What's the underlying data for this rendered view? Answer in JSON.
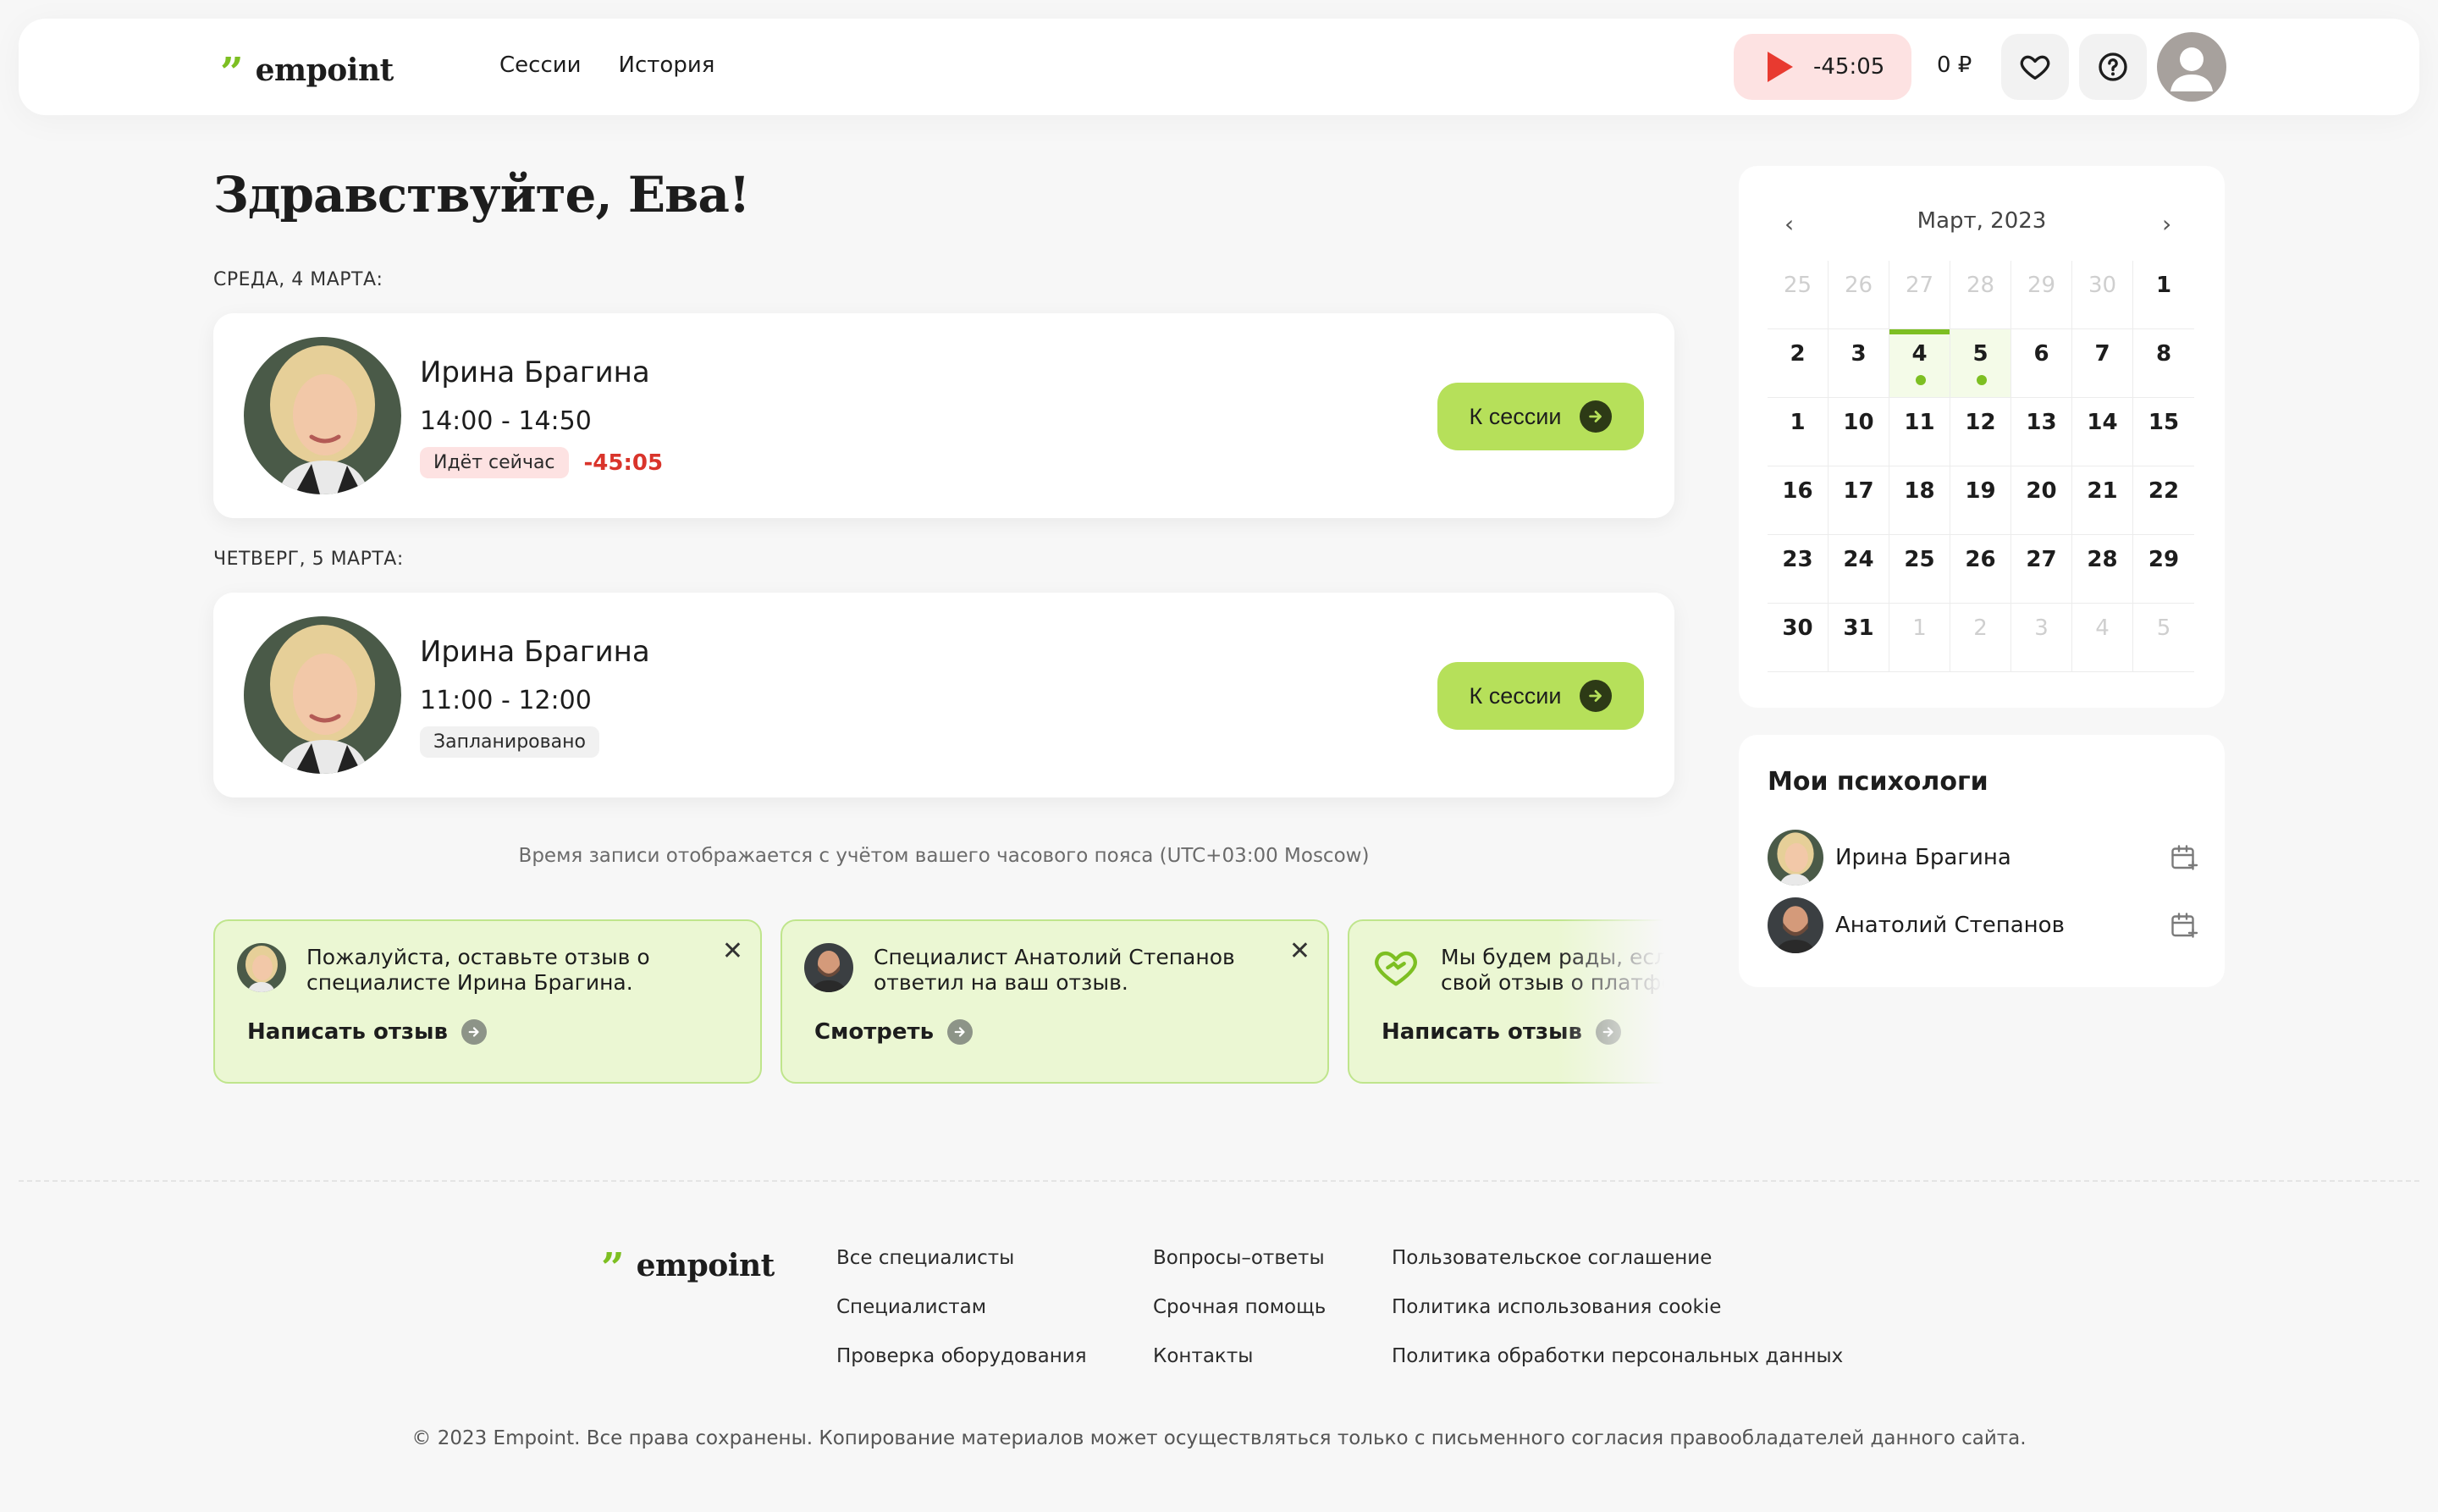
{
  "header": {
    "logo_text": "empoint",
    "nav": [
      "Сессии",
      "История"
    ],
    "timer": "-45:05",
    "balance": "0 ₽"
  },
  "greeting": "Здравствуйте, Ева!",
  "sessions": [
    {
      "day_label": "СРЕДА, 4 МАРТА:",
      "name": "Ирина Брагина",
      "time": "14:00 - 14:50",
      "status": "Идёт сейчас",
      "countdown": "-45:05",
      "button": "К сессии"
    },
    {
      "day_label": "ЧЕТВЕРГ, 5 МАРТА:",
      "name": "Ирина Брагина",
      "time": "11:00 - 12:00",
      "status": "Запланировано",
      "button": "К сессии"
    }
  ],
  "timezone_note": "Время записи отображается с учётом вашего часового пояса (UTC+03:00 Moscow)",
  "notifications": [
    {
      "text": "Пожалуйста, оставьте отзыв о специалисте Ирина Брагина.",
      "action": "Написать отзыв"
    },
    {
      "text": "Специалист Анатолий Степанов ответил на ваш отзыв.",
      "action": "Смотреть"
    },
    {
      "text": "Мы будем рады, если оставите свой отзыв о платформе",
      "action": "Написать отзыв"
    }
  ],
  "calendar": {
    "month": "Март, 2023",
    "days": [
      {
        "d": "25",
        "muted": true
      },
      {
        "d": "26",
        "muted": true
      },
      {
        "d": "27",
        "muted": true
      },
      {
        "d": "28",
        "muted": true
      },
      {
        "d": "29",
        "muted": true
      },
      {
        "d": "30",
        "muted": true
      },
      {
        "d": "1"
      },
      {
        "d": "2"
      },
      {
        "d": "3"
      },
      {
        "d": "4",
        "today": true,
        "dot": true
      },
      {
        "d": "5",
        "dot": true
      },
      {
        "d": "6"
      },
      {
        "d": "7"
      },
      {
        "d": "8"
      },
      {
        "d": "1"
      },
      {
        "d": "10"
      },
      {
        "d": "11"
      },
      {
        "d": "12"
      },
      {
        "d": "13"
      },
      {
        "d": "14"
      },
      {
        "d": "15"
      },
      {
        "d": "16"
      },
      {
        "d": "17"
      },
      {
        "d": "18"
      },
      {
        "d": "19"
      },
      {
        "d": "20"
      },
      {
        "d": "21"
      },
      {
        "d": "22"
      },
      {
        "d": "23"
      },
      {
        "d": "24"
      },
      {
        "d": "25"
      },
      {
        "d": "26"
      },
      {
        "d": "27"
      },
      {
        "d": "28"
      },
      {
        "d": "29"
      },
      {
        "d": "30"
      },
      {
        "d": "31"
      },
      {
        "d": "1",
        "muted": true
      },
      {
        "d": "2",
        "muted": true
      },
      {
        "d": "3",
        "muted": true
      },
      {
        "d": "4",
        "muted": true
      },
      {
        "d": "5",
        "muted": true
      }
    ]
  },
  "psychologists": {
    "title": "Мои психологи",
    "items": [
      "Ирина Брагина",
      "Анатолий Степанов"
    ]
  },
  "footer": {
    "logo_text": "empoint",
    "col1": [
      "Все специалисты",
      "Специалистам",
      "Проверка оборудования"
    ],
    "col2": [
      "Вопросы–ответы",
      "Срочная помощь",
      "Контакты"
    ],
    "col3": [
      "Пользовательское соглашение",
      "Политика использования cookie",
      "Политика обработки персональных данных"
    ],
    "copyright": "© 2023 Empoint. Все права сохранены. Копирование материалов может осуществляться только с письменного согласия правообладателей данного сайта."
  },
  "colors": {
    "accent_green": "#b6e05a",
    "brand_green": "#7dbf22",
    "alert_red": "#d9342b",
    "notification_bg": "#ebf7d3"
  }
}
